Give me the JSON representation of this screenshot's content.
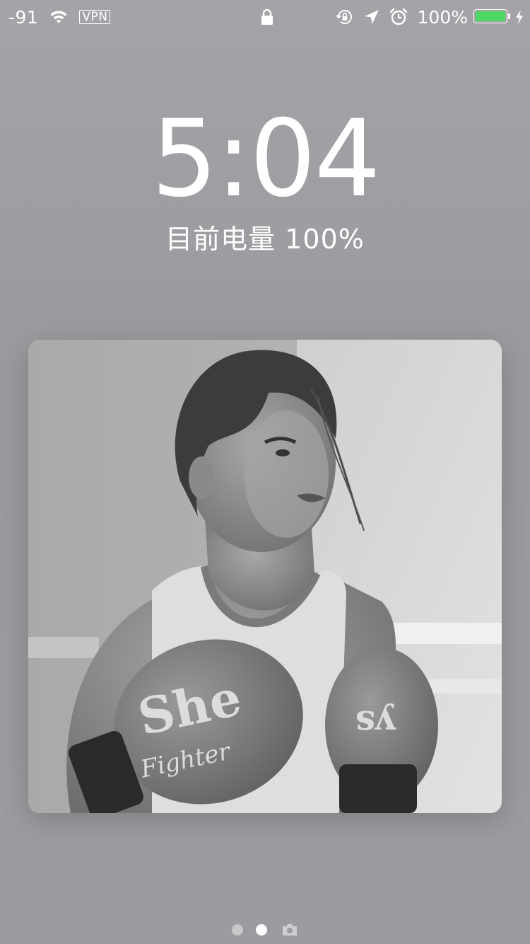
{
  "status_bar": {
    "signal": "-91",
    "vpn": "VPN",
    "battery_percent": "100%",
    "battery_level": 1.0,
    "icons": [
      "wifi-icon",
      "lock-icon",
      "rotation-lock-icon",
      "location-icon",
      "alarm-icon",
      "battery-icon",
      "charging-icon"
    ],
    "battery_color": "#4cd964"
  },
  "lock_screen": {
    "time": "5:04",
    "battery_status": "目前电量 100%"
  },
  "photo": {
    "glove_text_left": "She Fighter",
    "description_icon": "photo-image"
  },
  "page_indicator": {
    "pages": 3,
    "active_index": 1,
    "icons": [
      "dot",
      "dot",
      "camera-icon"
    ]
  }
}
